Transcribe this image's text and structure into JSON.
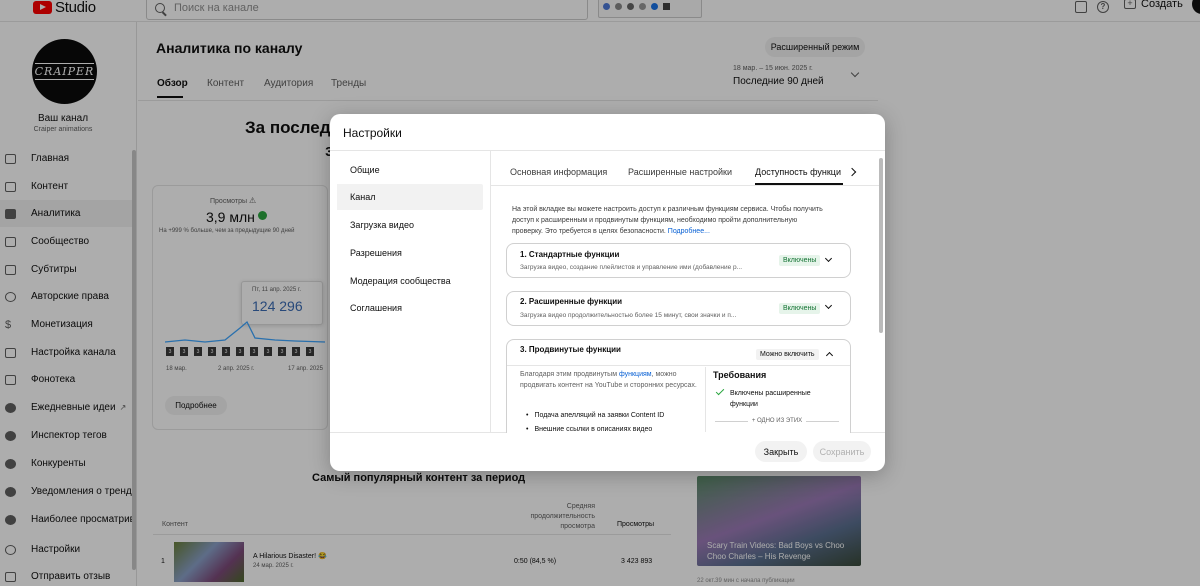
{
  "topbar": {
    "studio_label": "Studio",
    "search_placeholder": "Поиск на канале",
    "create_label": "Создать"
  },
  "channel": {
    "avatar_text": "CRAIPER",
    "name": "Ваш канал",
    "subtitle": "Craiper animations"
  },
  "sidebar": {
    "items": [
      {
        "label": "Главная",
        "icon": "dashboard-icon"
      },
      {
        "label": "Контент",
        "icon": "content-icon"
      },
      {
        "label": "Аналитика",
        "icon": "analytics-icon",
        "active": true
      },
      {
        "label": "Сообщество",
        "icon": "community-icon"
      },
      {
        "label": "Субтитры",
        "icon": "subtitles-icon"
      },
      {
        "label": "Авторские права",
        "icon": "copyright-icon"
      },
      {
        "label": "Монетизация",
        "icon": "monetization-icon"
      },
      {
        "label": "Настройка канала",
        "icon": "customization-icon"
      },
      {
        "label": "Фонотека",
        "icon": "audio-library-icon"
      },
      {
        "label": "Ежедневные идеи",
        "icon": "ideas-icon"
      },
      {
        "label": "Инспектор тегов",
        "icon": "tag-inspector-icon"
      },
      {
        "label": "Конкуренты",
        "icon": "competitors-icon"
      },
      {
        "label": "Уведомления о трендах",
        "icon": "trend-alerts-icon"
      },
      {
        "label": "Наиболее просматривае",
        "icon": "most-viewed-icon"
      },
      {
        "label": "Настройки",
        "icon": "settings-icon"
      },
      {
        "label": "Отправить отзыв",
        "icon": "feedback-icon"
      }
    ]
  },
  "main": {
    "title": "Аналитика по каналу",
    "advanced_mode": "Расширенный режим",
    "tabs": [
      "Обзор",
      "Контент",
      "Аудитория",
      "Тренды"
    ],
    "date_range": "18 мар. – 15 июн. 2025 г.",
    "date_label": "Последние 90 дней",
    "headline_1": "За последн",
    "headline_2": "з",
    "views_label": "Просмотры",
    "views_value": "3,9 млн",
    "views_compare": "На +999 % больше, чем за предыдущие 90 дней",
    "tooltip_date": "Пт, 11 апр. 2025 г.",
    "tooltip_value": "124 296",
    "axis_labels": [
      "18 мар.",
      "2 апр. 2025 г.",
      "17 апр. 2025"
    ],
    "more_button": "Подробнее",
    "popular_heading": "Самый популярный контент за период",
    "table": {
      "col_content": "Контент",
      "col_avg": "Средняя продолжительность просмотра",
      "col_views": "Просмотры",
      "rows": [
        {
          "num": "1",
          "title": "A Hilarious Disaster! 😂",
          "date": "24 мар. 2025 г.",
          "avg": "0:50  (84,5 %)",
          "views": "3 423 893"
        }
      ]
    },
    "video_card_title": "Scary Train Videos: Bad Boys vs Choo Choo Charles – His Revenge",
    "video_card_foot": "22 окт.39 мин с начала публикации"
  },
  "dialog": {
    "title": "Настройки",
    "nav": [
      "Общие",
      "Канал",
      "Загрузка видео",
      "Разрешения",
      "Модерация сообщества",
      "Соглашения"
    ],
    "nav_active": 1,
    "tabs": [
      "Основная информация",
      "Расширенные настройки",
      "Доступность функци"
    ],
    "intro_text": "На этой вкладке вы можете настроить доступ к различным функциям сервиса. Чтобы получить доступ к расширенным и продвинутым функциям, необходимо пройти дополнительную проверку. Это требуется в целях безопасности.",
    "intro_link": "Подробнее...",
    "features": [
      {
        "title": "1. Стандартные функции",
        "desc": "Загрузка видео, создание плейлистов и управление ими (добавление р...",
        "badge": "Включены"
      },
      {
        "title": "2. Расширенные функции",
        "desc": "Загрузка видео продолжительностью более 15 минут, свои значки и п...",
        "badge": "Включены"
      },
      {
        "title": "3. Продвинутые функции",
        "badge": "Можно включить"
      }
    ],
    "advanced": {
      "body_pre": "Благодаря этим продвинутым ",
      "body_link": "функциям",
      "body_post": ", можно продвигать контент на YouTube и сторонних ресурсах.",
      "bullets": [
        "Подача апелляций на заявки Content ID",
        "Внешние ссылки в описаниях видео"
      ],
      "req_title": "Требования",
      "req_item": "Включены расширенные функции",
      "req_or": "+ ОДНО ИЗ ЭТИХ"
    },
    "close_label": "Закрыть",
    "save_label": "Сохранить"
  }
}
